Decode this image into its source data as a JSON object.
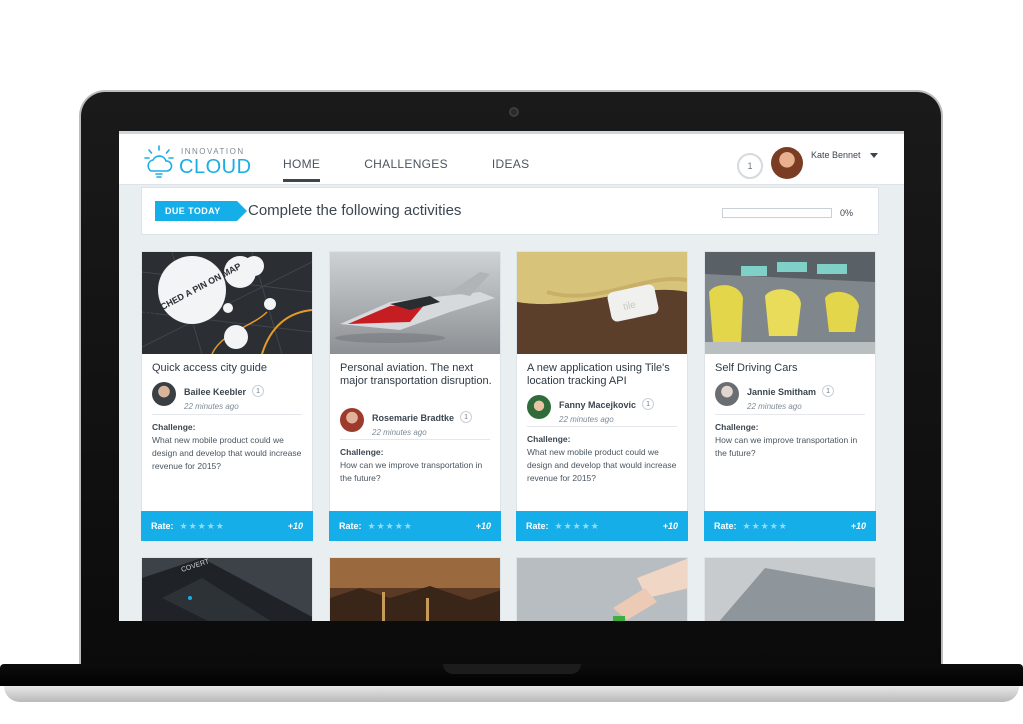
{
  "header": {
    "logo_small": "INNOVATION",
    "logo_big": "CLOUD",
    "nav": [
      {
        "label": "HOME"
      },
      {
        "label": "CHALLENGES"
      },
      {
        "label": "IDEAS"
      }
    ],
    "notification_count": "1",
    "user_name": "Kate Bennet"
  },
  "due": {
    "tag": "DUE TODAY",
    "title": "Complete the following activities",
    "progress_value": 0,
    "progress_text": "0%"
  },
  "cards": [
    {
      "title": "Quick access city guide",
      "author": "Bailee Keebler",
      "time": "22 minutes ago",
      "badge": "1",
      "challenge_label": "Challenge:",
      "challenge_text": "What new mobile product could we design and develop that would increase revenue for 2015?",
      "rate_label": "Rate:",
      "stars": "★★★★★",
      "points": "+10",
      "image_text": "TOUCHED A PIN ON MAP"
    },
    {
      "title": "Personal aviation. The next major transportation disruption.",
      "author": "Rosemarie Bradtke",
      "time": "22 minutes ago",
      "badge": "1",
      "challenge_label": "Challenge:",
      "challenge_text": "How can we improve transportation in the future?",
      "rate_label": "Rate:",
      "stars": "★★★★★",
      "points": "+10"
    },
    {
      "title": "A new application using Tile's location tracking API",
      "author": "Fanny Macejkovic",
      "time": "22 minutes ago",
      "badge": "1",
      "challenge_label": "Challenge:",
      "challenge_text": "What new mobile product could we design and develop that would increase revenue for 2015?",
      "rate_label": "Rate:",
      "stars": "★★★★★",
      "points": "+10",
      "image_text": "tile"
    },
    {
      "title": "Self Driving Cars",
      "author": "Jannie Smitham",
      "time": "22 minutes ago",
      "badge": "1",
      "challenge_label": "Challenge:",
      "challenge_text": "How can we improve transportation in the future?",
      "rate_label": "Rate:",
      "stars": "★★★★★",
      "points": "+10"
    }
  ],
  "bottom_cards": [
    {
      "image_text": "COVERT"
    }
  ],
  "colors": {
    "accent": "#16aee9",
    "text_dark": "#2f3a44",
    "background": "#e9eef1"
  }
}
